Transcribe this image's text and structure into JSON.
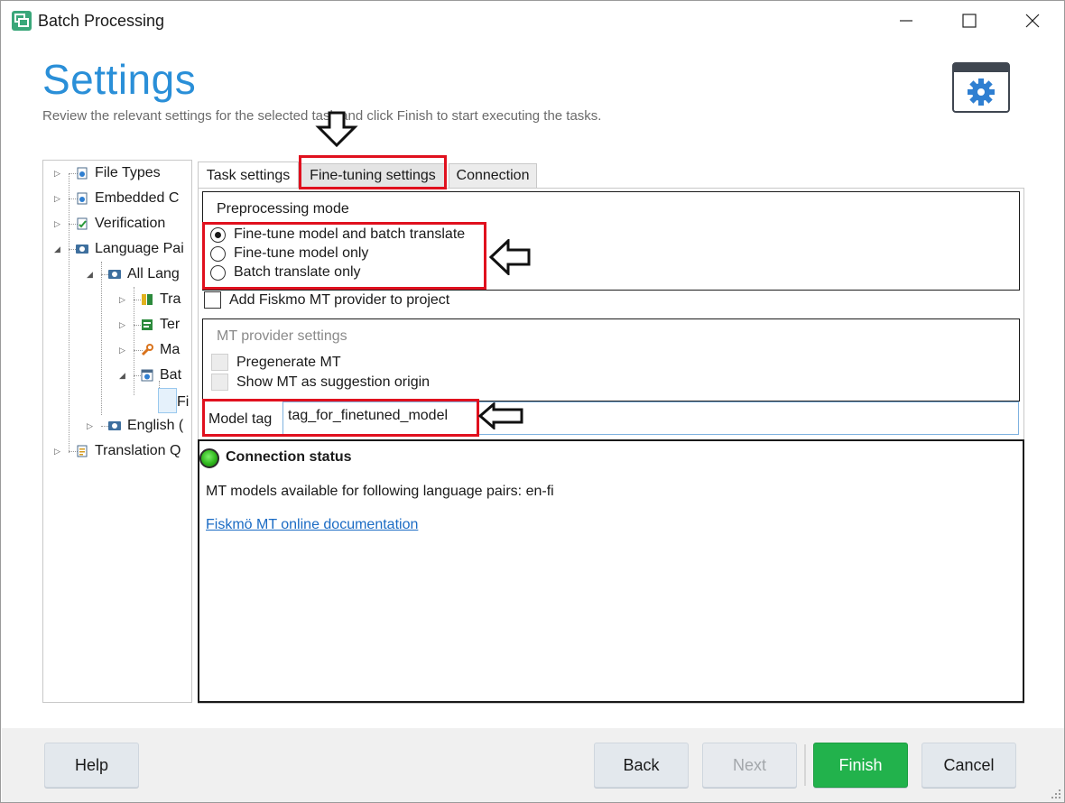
{
  "window": {
    "title": "Batch Processing"
  },
  "header": {
    "title": "Settings",
    "subtitle": "Review the relevant settings for the selected task and click Finish to start executing the tasks."
  },
  "tree": {
    "items": [
      {
        "label": "File Types",
        "icon": "file-types-icon"
      },
      {
        "label": "Embedded C",
        "icon": "embedded-content-icon"
      },
      {
        "label": "Verification",
        "icon": "verification-icon"
      },
      {
        "label": "Language Pai",
        "icon": "language-pairs-icon"
      },
      {
        "label": "All Lang",
        "icon": "language-pairs-icon"
      },
      {
        "label": "Tra",
        "icon": "translation-memory-icon"
      },
      {
        "label": "Ter",
        "icon": "termbase-icon"
      },
      {
        "label": "Ma",
        "icon": "wrench-icon"
      },
      {
        "label": "Bat",
        "icon": "batch-settings-icon"
      },
      {
        "label": "Fi",
        "icon": ""
      },
      {
        "label": "English (",
        "icon": "language-pairs-icon"
      },
      {
        "label": "Translation Q",
        "icon": "translation-quality-icon"
      }
    ]
  },
  "tabs": {
    "task": "Task settings",
    "fine": "Fine-tuning settings",
    "connection": "Connection"
  },
  "preprocessing": {
    "title": "Preprocessing mode",
    "options": [
      {
        "label": "Fine-tune model and batch translate",
        "selected": true
      },
      {
        "label": "Fine-tune model only",
        "selected": false
      },
      {
        "label": "Batch translate only",
        "selected": false
      }
    ]
  },
  "add_provider": {
    "label": "Add Fiskmo MT provider to project",
    "checked": false
  },
  "mt_provider": {
    "title": "MT provider settings",
    "pregenerate": "Pregenerate MT",
    "show_origin": "Show MT as suggestion origin"
  },
  "model_tag": {
    "label": "Model tag",
    "value": "tag_for_finetuned_model"
  },
  "connection": {
    "title": "Connection status",
    "state_color": "#2fb61c",
    "models_text": "MT models available for following language pairs: en-fi",
    "doc_link": "Fiskmö MT online documentation"
  },
  "buttons": {
    "help": "Help",
    "back": "Back",
    "next": "Next",
    "finish": "Finish",
    "cancel": "Cancel"
  },
  "colors": {
    "accent": "#2a8fd8",
    "finish": "#22b24c",
    "highlight": "#e0101e"
  }
}
